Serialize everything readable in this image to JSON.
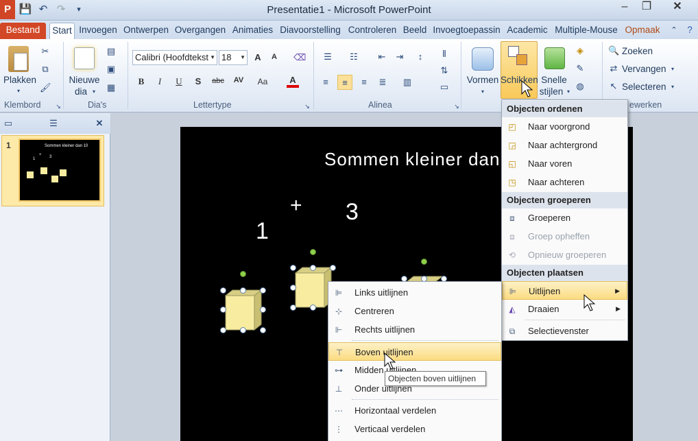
{
  "window": {
    "title": "Presentatie1 - Microsoft PowerPoint",
    "app_icon_letter": "P",
    "minimize": "–",
    "restore": "❐",
    "close": "✕"
  },
  "tabs": [
    "Bestand",
    "Start",
    "Invoegen",
    "Ontwerpen",
    "Overgangen",
    "Animaties",
    "Diavoorstelling",
    "Controleren",
    "Beeld",
    "Invoegtoepassin",
    "Academic",
    "Multiple-Mouse",
    "Opmaak"
  ],
  "ribbon": {
    "groups": {
      "klembord": "Klembord",
      "dias": "Dia's",
      "lettertype": "Lettertype",
      "alinea": "Alinea",
      "bewerken": "ewerken"
    },
    "plakken": "Plakken",
    "nieuwe_dia_1": "Nieuwe",
    "nieuwe_dia_2": "dia",
    "font_name": "Calibri (Hoofdtekst",
    "font_size": "18",
    "vormen": "Vormen",
    "schikken": "Schikken",
    "snelle_1": "Snelle",
    "snelle_2": "stijlen",
    "zoeken": "Zoeken",
    "vervangen": "Vervangen",
    "selecteren": "Selecteren",
    "bold": "B",
    "italic": "I",
    "underline": "U",
    "shadow": "S",
    "strike": "abc",
    "spacing": "AV",
    "case": "Aa",
    "fontcolor": "A"
  },
  "slides_pane": {
    "slide_number": "1",
    "thumb_title": "Sommen kleiner dan 10",
    "thumb_1": "1",
    "thumb_plus": "+",
    "thumb_3": "3"
  },
  "slide": {
    "title": "Sommen kleiner dan 1",
    "num1": "1",
    "plus": "+",
    "num3": "3"
  },
  "schikken_menu": {
    "header_ordenen": "Objecten ordenen",
    "items_ordenen": [
      "Naar voorgrond",
      "Naar achtergrond",
      "Naar voren",
      "Naar achteren"
    ],
    "header_groeperen": "Objecten groeperen",
    "items_groeperen": [
      "Groeperen",
      "Groep opheffen",
      "Opnieuw groeperen"
    ],
    "header_plaatsen": "Objecten plaatsen",
    "uitlijnen": "Uitlijnen",
    "draaien": "Draaien",
    "selectievenster": "Selectievenster"
  },
  "uitlijnen_menu": {
    "items": [
      "Links uitlijnen",
      "Centreren",
      "Rechts uitlijnen",
      "Boven uitlijnen",
      "Midden uitlijnen",
      "Onder uitlijnen",
      "Horizontaal verdelen",
      "Verticaal verdelen"
    ]
  },
  "tooltip": "Objecten boven uitlijnen",
  "colors": {
    "file_tab": "#d24726",
    "highlight": "#fbdc82",
    "cube_face": "#f7eca0",
    "slide_bg": "#000000"
  }
}
